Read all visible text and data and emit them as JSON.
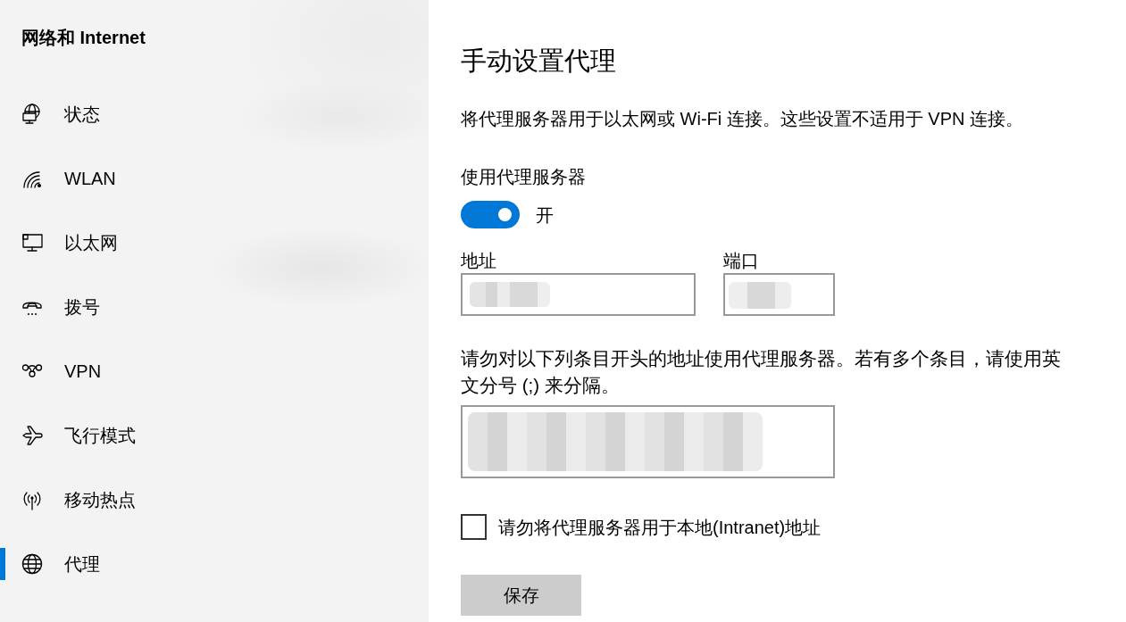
{
  "sidebar": {
    "title": "网络和 Internet",
    "items": [
      {
        "label": "状态",
        "selected": false
      },
      {
        "label": "WLAN",
        "selected": false
      },
      {
        "label": "以太网",
        "selected": false
      },
      {
        "label": "拨号",
        "selected": false
      },
      {
        "label": "VPN",
        "selected": false
      },
      {
        "label": "飞行模式",
        "selected": false
      },
      {
        "label": "移动热点",
        "selected": false
      },
      {
        "label": "代理",
        "selected": true
      }
    ]
  },
  "main": {
    "title": "手动设置代理",
    "description": "将代理服务器用于以太网或 Wi-Fi 连接。这些设置不适用于 VPN 连接。",
    "proxy_switch": {
      "label": "使用代理服务器",
      "on": true,
      "state_text": "开"
    },
    "address": {
      "label": "地址",
      "redacted": true
    },
    "port": {
      "label": "端口",
      "redacted": true
    },
    "exceptions": {
      "description": "请勿对以下列条目开头的地址使用代理服务器。若有多个条目，请使用英文分号 (;) 来分隔。",
      "redacted": true
    },
    "local_bypass": {
      "label": "请勿将代理服务器用于本地(Intranet)地址",
      "checked": false
    },
    "save_button": "保存"
  }
}
